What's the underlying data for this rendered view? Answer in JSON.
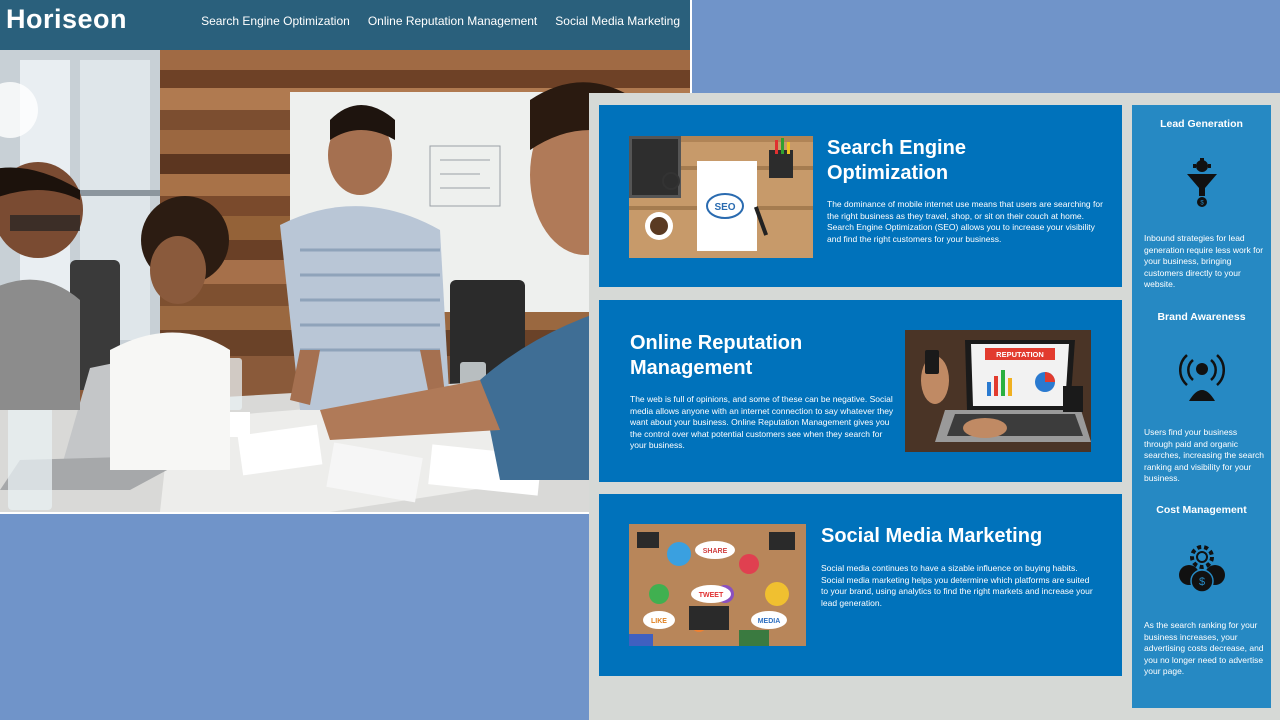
{
  "header": {
    "logo": "Horiseon",
    "nav": [
      "Search Engine Optimization",
      "Online Reputation Management",
      "Social Media Marketing"
    ]
  },
  "cards": [
    {
      "title_l1": "Search Engine",
      "title_l2": "Optimization",
      "body": "The dominance of mobile internet use means that users are searching for the right business as they travel, shop, or sit on their couch at home. Search Engine Optimization (SEO) allows you to increase your visibility and find the right customers for your business."
    },
    {
      "title_l1": "Online Reputation",
      "title_l2": "Management",
      "body": "The web is full of opinions, and some of these can be negative. Social media allows anyone with an internet connection to say whatever they want about your business. Online Reputation Management gives you the control over what potential customers see when they search for your business."
    },
    {
      "title_l1": "Social Media Marketing",
      "body": "Social media continues to have a sizable influence on buying habits. Social media marketing helps you determine which platforms are suited to your brand, using analytics to find the right markets and increase your lead generation."
    }
  ],
  "thumb_text": {
    "seo": "SEO",
    "reputation": "REPUTATION",
    "tweet": "TWEET",
    "like": "LIKE",
    "media": "MEDIA",
    "share": "SHARE"
  },
  "aside": [
    {
      "title": "Lead Generation",
      "body": "Inbound strategies for lead generation require less work for your business, bringing customers directly to your website."
    },
    {
      "title": "Brand Awareness",
      "body": "Users find your business through paid and organic searches, increasing the search ranking and visibility for your business."
    },
    {
      "title": "Cost Management",
      "body": "As the search ranking for your business increases, your advertising costs decrease, and you no longer need to advertise your page."
    }
  ],
  "colors": {
    "background": "#7094c9",
    "header": "#2a607c",
    "card": "#0072bb",
    "aside": "#2689c3",
    "panel": "#d6d9d6"
  }
}
